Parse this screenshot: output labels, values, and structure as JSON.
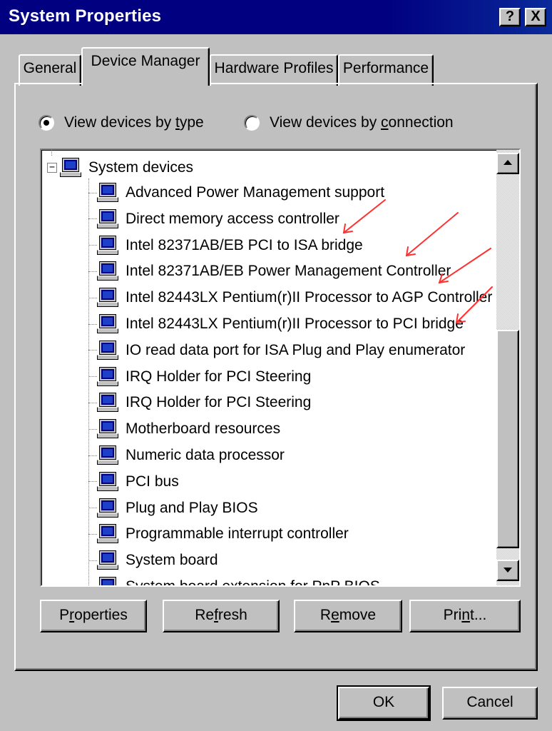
{
  "window": {
    "title": "System Properties",
    "help_glyph": "?",
    "close_glyph": "X"
  },
  "tabs": [
    {
      "label": "General",
      "active": false
    },
    {
      "label": "Device Manager",
      "active": true
    },
    {
      "label": "Hardware Profiles",
      "active": false
    },
    {
      "label": "Performance",
      "active": false
    }
  ],
  "view_options": {
    "by_type_pre": "View devices by ",
    "by_type_u": "t",
    "by_type_post": "ype",
    "by_type_checked": true,
    "by_connection_pre": "View devices by ",
    "by_connection_u": "c",
    "by_connection_post": "onnection",
    "by_connection_checked": false
  },
  "tree": {
    "root_label": "System devices",
    "expander": "−",
    "items": [
      "Advanced Power Management support",
      "Direct memory access controller",
      "Intel 82371AB/EB PCI to ISA bridge",
      "Intel 82371AB/EB Power Management Controller",
      "Intel 82443LX Pentium(r)II Processor to AGP Controller",
      "Intel 82443LX Pentium(r)II Processor to PCI bridge",
      "IO read data port for ISA Plug and Play enumerator",
      "IRQ Holder for PCI Steering",
      "IRQ Holder for PCI Steering",
      "Motherboard resources",
      "Numeric data processor",
      "PCI bus",
      "Plug and Play BIOS",
      "Programmable interrupt controller",
      "System board",
      "System board extension for PnP BIOS"
    ]
  },
  "buttons": {
    "properties_pre": "P",
    "properties_u": "r",
    "properties_post": "operties",
    "refresh_pre": "Re",
    "refresh_u": "f",
    "refresh_post": "resh",
    "remove_pre": "R",
    "remove_u": "e",
    "remove_post": "move",
    "print_pre": "Pri",
    "print_u": "n",
    "print_post": "t...",
    "ok": "OK",
    "cancel": "Cancel"
  },
  "colors": {
    "title_bar": "#000080",
    "face": "#c0c0c0",
    "annotation_arrow": "#ff3030"
  },
  "icons": {
    "device_icon": "computer-monitor-icon",
    "annotation": "red-arrow-icon"
  }
}
